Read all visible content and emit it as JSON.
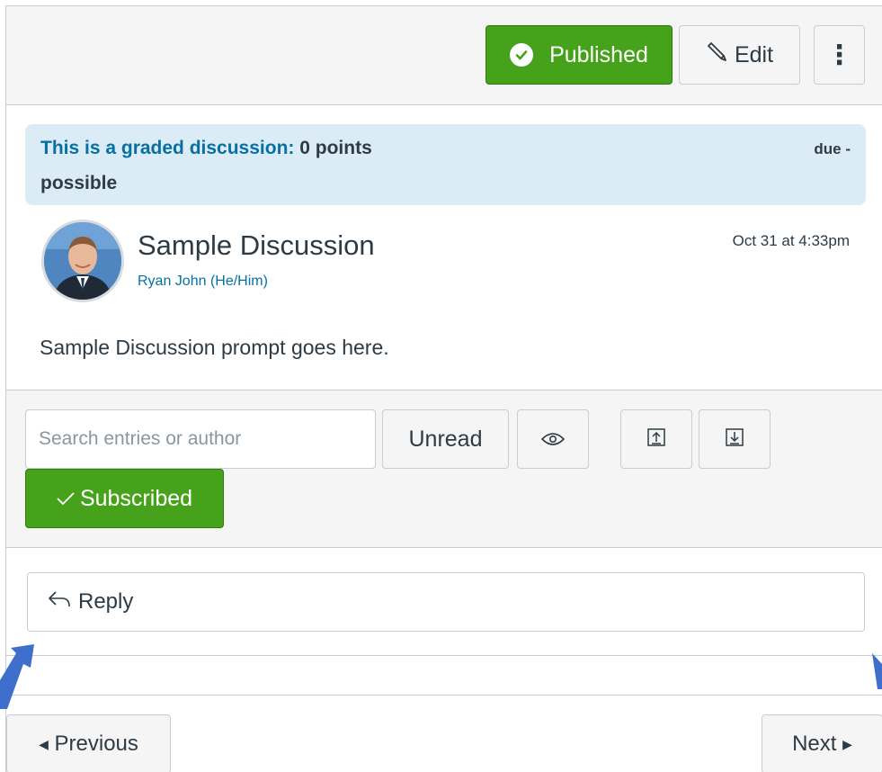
{
  "toolbar": {
    "published_label": "Published",
    "edit_label": "Edit",
    "more_label": "⋮"
  },
  "banner": {
    "intro_text": "This is a graded discussion:",
    "points_text": "0 points",
    "points_suffix": "possible",
    "due_text": "due -"
  },
  "post": {
    "title": "Sample Discussion",
    "author": "Ryan John (He/Him)",
    "timestamp": "Oct 31 at 4:33pm",
    "body": "Sample Discussion prompt goes here."
  },
  "filters": {
    "search_placeholder": "Search entries or author",
    "unread_label": "Unread",
    "subscribed_label": "Subscribed"
  },
  "reply": {
    "label": "Reply"
  },
  "pagination": {
    "previous_label": "Previous",
    "next_label": "Next"
  },
  "icons": {
    "published": "check-circle-icon",
    "edit": "pencil-icon",
    "more": "kebab-icon",
    "eye": "eye-icon",
    "expand_up": "upload-arrow-icon",
    "expand_down": "download-arrow-icon",
    "subscribed": "checkmark-icon",
    "reply": "reply-arrow-icon"
  },
  "colors": {
    "success": "#45a21a",
    "link": "#0770a3",
    "banner": "#dcecf7",
    "annotation_arrow": "#3f6fcc"
  }
}
